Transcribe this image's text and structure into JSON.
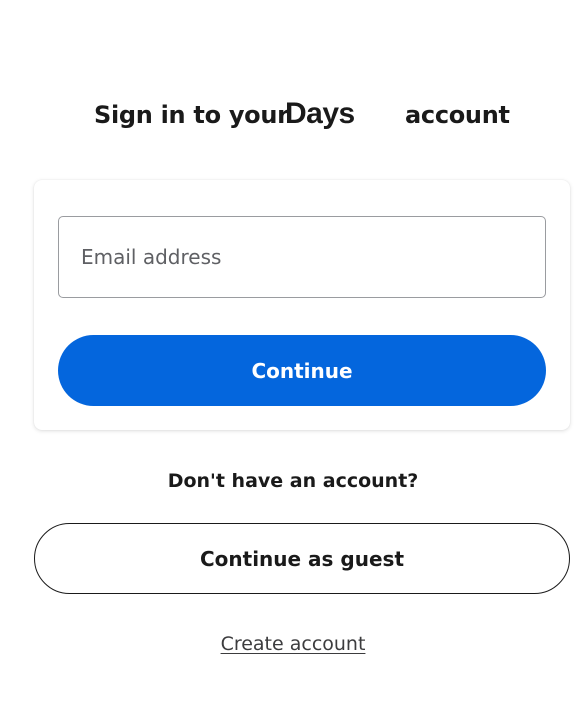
{
  "heading": {
    "prefix": "Sign in to your",
    "brand": "Days",
    "suffix": "account"
  },
  "signin_form": {
    "email_placeholder": "Email address",
    "email_value": "",
    "continue_label": "Continue"
  },
  "guest": {
    "prompt": "Don't have an account?",
    "continue_guest_label": "Continue as guest",
    "create_account_label": "Create account"
  },
  "colors": {
    "primary_button": "#0466dd",
    "text": "#1a1a1a",
    "field_border": "#9a9ca0"
  }
}
